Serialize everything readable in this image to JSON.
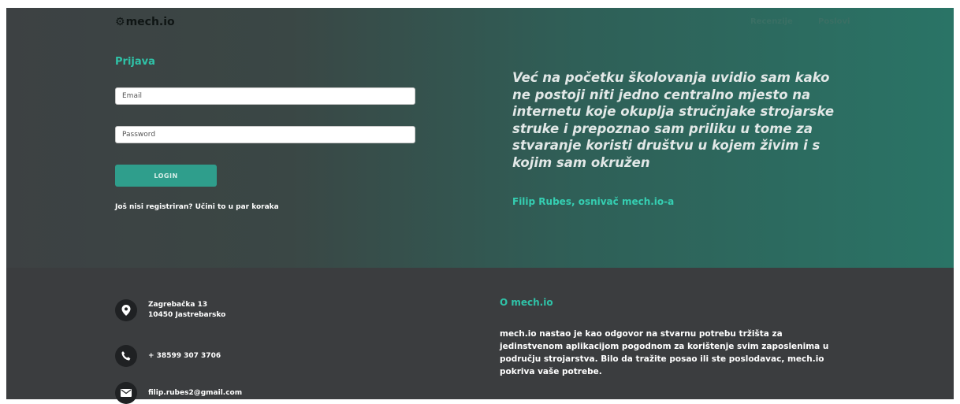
{
  "header": {
    "logo_text": "mech.io",
    "logo_icon": "gear-icon",
    "nav": {
      "reviews": "Recenzije",
      "jobs": "Poslovi"
    }
  },
  "login": {
    "title": "Prijava",
    "email_placeholder": "Email",
    "password_placeholder": "Password",
    "login_button": "LOGIN",
    "register_text": "Još nisi registriran? Učini to u par koraka"
  },
  "quote": {
    "text": "Već na početku školovanja uvidio sam kako ne postoji niti jedno centralno mjesto na internetu koje okuplja stručnjake strojarske struke i prepoznao sam priliku u tome za stvaranje koristi društvu u kojem živim i s kojim sam okružen",
    "author": "Filip Rubes, osnivač mech.io-a"
  },
  "footer": {
    "address_line1": "Zagrebačka 13",
    "address_line2": "10450 Jastrebarsko",
    "phone": "+ 38599 307 3706",
    "email": "filip.rubes2@gmail.com",
    "about_title": "O mech.io",
    "about_text": "mech.io nastao je kao odgovor na stvarnu potrebu tržišta za jedinstvenom aplikacijom pogodnom za korištenje svim zaposlenima u području strojarstva. Bilo da tražite posao ili ste poslodavac, mech.io pokriva vaše potrebe."
  },
  "colors": {
    "accent": "#2fc3a8",
    "button": "#2f9e8c",
    "footer_bg": "#3b3d3f"
  }
}
